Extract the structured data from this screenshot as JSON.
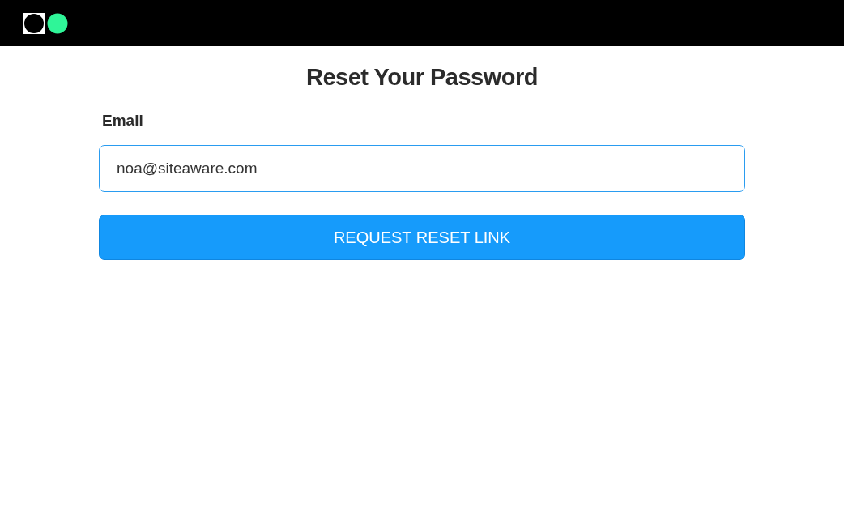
{
  "title": "Reset Your Password",
  "email": {
    "label": "Email",
    "value": "noa@siteaware.com"
  },
  "button": "REQUEST RESET LINK"
}
